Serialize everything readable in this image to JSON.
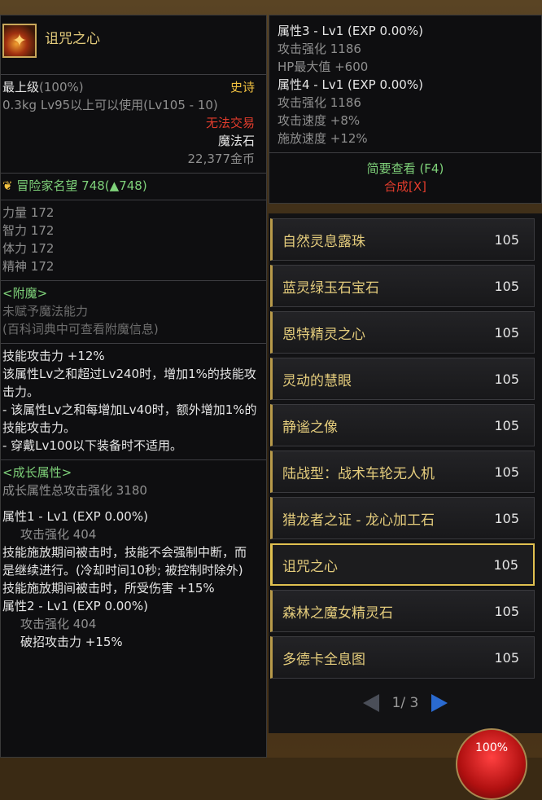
{
  "left": {
    "item_name": "诅咒之心",
    "grade": "最上级",
    "grade_pct": "(100%)",
    "rarity": "史诗",
    "weight": "0.3kg",
    "level_req": "Lv95以上可以使用(Lv105 - 10)",
    "trade": "无法交易",
    "type": "魔法石",
    "price": "22,377金币",
    "fame_label": "冒险家名望",
    "fame_value": "748(",
    "fame_up": "748)",
    "stats": [
      {
        "name": "力量",
        "value": "172"
      },
      {
        "name": "智力",
        "value": "172"
      },
      {
        "name": "体力",
        "value": "172"
      },
      {
        "name": "精神",
        "value": "172"
      }
    ],
    "enchant_title": "<附魔>",
    "enchant_none": "未赋予魔法能力",
    "enchant_hint": "(百科词典中可查看附魔信息)",
    "skill_lines": [
      "技能攻击力 +12%",
      "该属性Lv之和超过Lv240时，增加1%的技能攻击力。",
      "- 该属性Lv之和每增加Lv40时，额外增加1%的技能攻击力。",
      "- 穿戴Lv100以下装备时不适用。"
    ],
    "growth_title": "<成长属性>",
    "growth_total": "成长属性总攻击强化 3180",
    "attr1_title": "属性1 - Lv1 (EXP 0.00%)",
    "attr1_atk": "攻击强化 404",
    "attr1_desc1": "技能施放期间被击时，技能不会强制中断，而是继续进行。(冷却时间10秒; 被控制时除外)",
    "attr1_desc2": "技能施放期间被击时，所受伤害 +15%",
    "attr2_title": "属性2 - Lv1 (EXP 0.00%)",
    "attr2_atk": "攻击强化 404",
    "attr2_extra": "破招攻击力 +15%"
  },
  "right": {
    "attr3_title": "属性3 - Lv1 (EXP 0.00%)",
    "attr3_atk": "攻击强化 1186",
    "attr3_hp": "HP最大值 +600",
    "attr4_title": "属性4 - Lv1 (EXP 0.00%)",
    "attr4_atk": "攻击强化 1186",
    "attr4_speed": "攻击速度 +8%",
    "attr4_cast": "施放速度 +12%",
    "brief_view": "简要查看 (F4)",
    "synthesize": "合成[X]"
  },
  "list": {
    "items": [
      {
        "name": "自然灵息露珠",
        "level": "105"
      },
      {
        "name": "蓝灵绿玉石宝石",
        "level": "105"
      },
      {
        "name": "恩特精灵之心",
        "level": "105"
      },
      {
        "name": "灵动的慧眼",
        "level": "105"
      },
      {
        "name": "静谧之像",
        "level": "105"
      },
      {
        "name": "陆战型：战术车轮无人机",
        "level": "105"
      },
      {
        "name": "猎龙者之证 - 龙心加工石",
        "level": "105"
      },
      {
        "name": "诅咒之心",
        "level": "105"
      },
      {
        "name": "森林之魔女精灵石",
        "level": "105"
      },
      {
        "name": "多德卡全息图",
        "level": "105"
      }
    ],
    "selected_index": 7,
    "page": "1/ 3"
  },
  "hud": {
    "hp": "100%"
  },
  "icons": {
    "fame": "fame-crest-icon",
    "item": "cursed-heart-icon"
  }
}
